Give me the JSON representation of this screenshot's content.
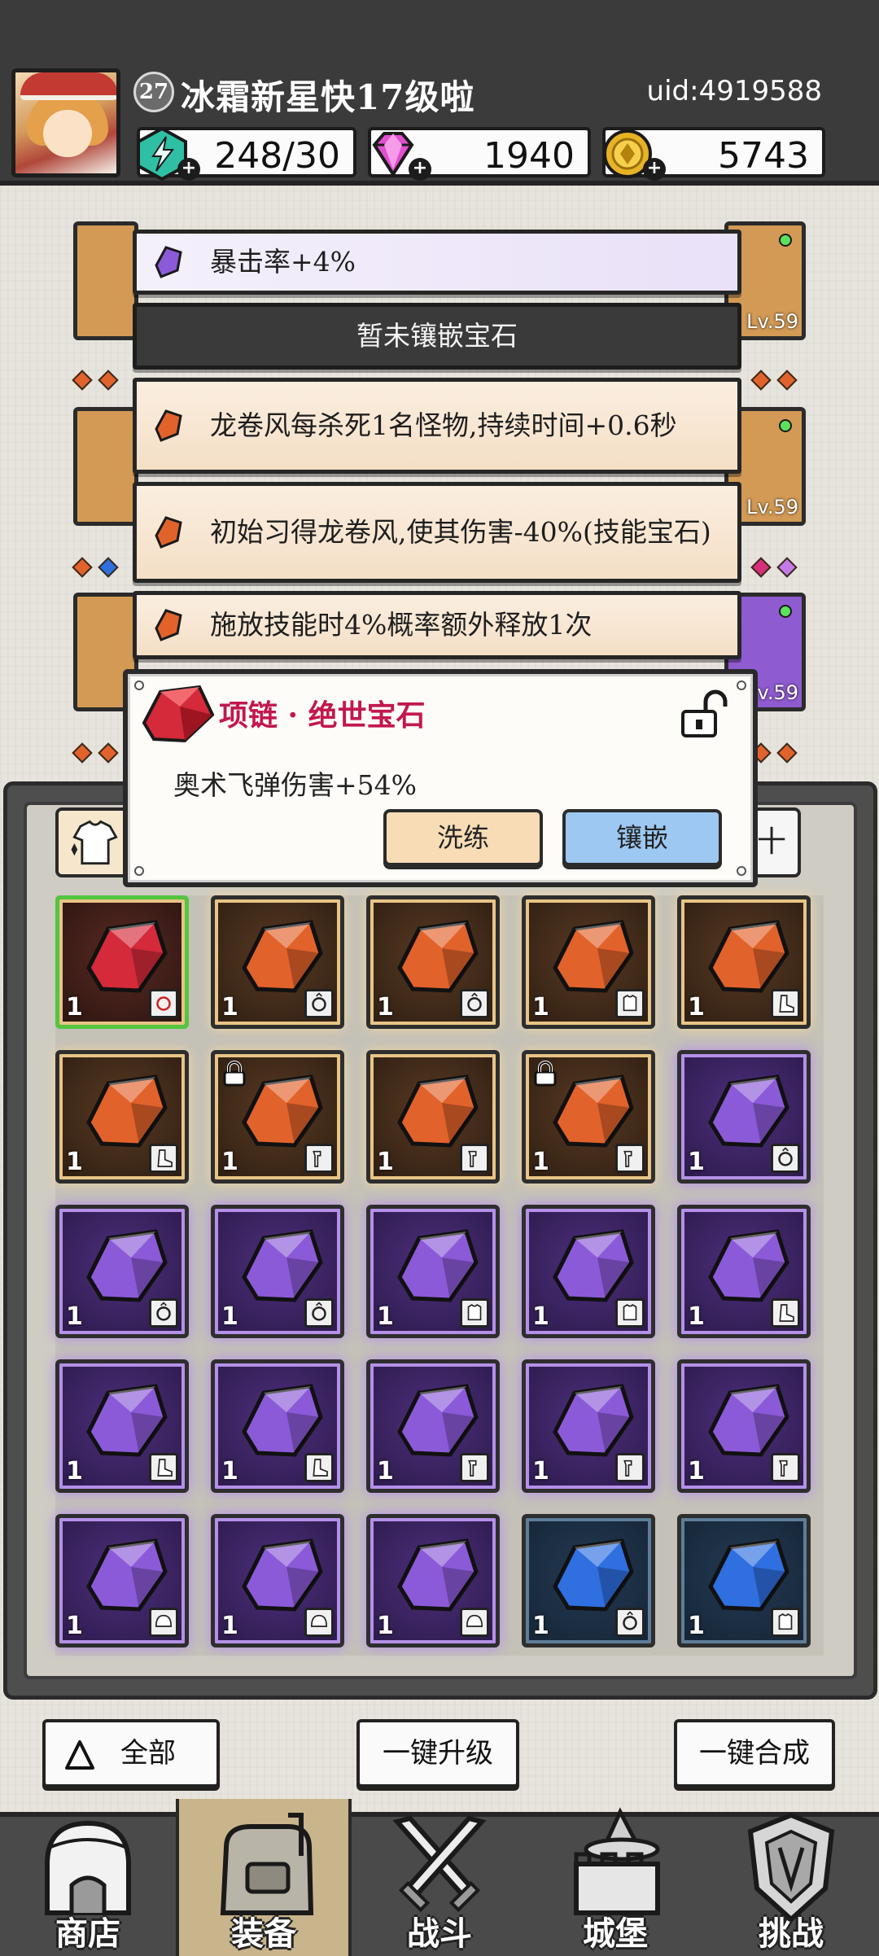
{
  "player": {
    "level": "27",
    "name": "冰霜新星快17级啦",
    "uid": "uid:4919588"
  },
  "resources": {
    "energy": "248/30",
    "gems": "1940",
    "coins": "5743"
  },
  "equipment": {
    "levels": [
      "Lv.59",
      "Lv.59",
      "Lv.59"
    ]
  },
  "affixes": [
    {
      "text": "暴击率+4%",
      "rarity": "purple"
    },
    {
      "text": "暂未镶嵌宝石",
      "rarity": "empty"
    },
    {
      "text": "龙卷风每杀死1名怪物,持续时间+0.6秒",
      "rarity": "orange"
    },
    {
      "text": "初始习得龙卷风,使其伤害-40%(技能宝石)",
      "rarity": "orange"
    },
    {
      "text": "施放技能时4%概率额外释放1次",
      "rarity": "orange"
    }
  ],
  "gem_dialog": {
    "title": "项链 · 绝世宝石",
    "description": "奥术飞弹伤害+54%",
    "wash_label": "洗练",
    "inlay_label": "镶嵌"
  },
  "filter": {
    "right_label": "十"
  },
  "inventory": [
    {
      "rarity": "red",
      "count": "1",
      "type": "necklace",
      "locked": false
    },
    {
      "rarity": "orange",
      "count": "1",
      "type": "ring",
      "locked": false
    },
    {
      "rarity": "orange",
      "count": "1",
      "type": "ring",
      "locked": false
    },
    {
      "rarity": "orange",
      "count": "1",
      "type": "armor",
      "locked": false
    },
    {
      "rarity": "orange",
      "count": "1",
      "type": "boots",
      "locked": false
    },
    {
      "rarity": "orange",
      "count": "1",
      "type": "boots",
      "locked": false
    },
    {
      "rarity": "orange",
      "count": "1",
      "type": "weapon",
      "locked": true
    },
    {
      "rarity": "orange",
      "count": "1",
      "type": "weapon",
      "locked": false
    },
    {
      "rarity": "orange",
      "count": "1",
      "type": "weapon",
      "locked": true
    },
    {
      "rarity": "purple",
      "count": "1",
      "type": "ring",
      "locked": false
    },
    {
      "rarity": "purple",
      "count": "1",
      "type": "ring",
      "locked": false
    },
    {
      "rarity": "purple",
      "count": "1",
      "type": "ring",
      "locked": false
    },
    {
      "rarity": "purple",
      "count": "1",
      "type": "armor",
      "locked": false
    },
    {
      "rarity": "purple",
      "count": "1",
      "type": "armor",
      "locked": false
    },
    {
      "rarity": "purple",
      "count": "1",
      "type": "boots",
      "locked": false
    },
    {
      "rarity": "purple",
      "count": "1",
      "type": "boots",
      "locked": false
    },
    {
      "rarity": "purple",
      "count": "1",
      "type": "boots",
      "locked": false
    },
    {
      "rarity": "purple",
      "count": "1",
      "type": "weapon",
      "locked": false
    },
    {
      "rarity": "purple",
      "count": "1",
      "type": "weapon",
      "locked": false
    },
    {
      "rarity": "purple",
      "count": "1",
      "type": "weapon",
      "locked": false
    },
    {
      "rarity": "purple",
      "count": "1",
      "type": "helmet",
      "locked": false
    },
    {
      "rarity": "purple",
      "count": "1",
      "type": "helmet",
      "locked": false
    },
    {
      "rarity": "purple",
      "count": "1",
      "type": "helmet",
      "locked": false
    },
    {
      "rarity": "blue",
      "count": "1",
      "type": "ring",
      "locked": false
    },
    {
      "rarity": "blue",
      "count": "1",
      "type": "armor",
      "locked": false
    }
  ],
  "actions": {
    "all_label": "全部",
    "upgrade_label": "一键升级",
    "merge_label": "一键合成"
  },
  "nav": [
    {
      "label": "商店",
      "icon": "shop-icon"
    },
    {
      "label": "装备",
      "icon": "equipment-bag-icon",
      "active": true
    },
    {
      "label": "战斗",
      "icon": "crossed-swords-icon"
    },
    {
      "label": "城堡",
      "icon": "castle-icon"
    },
    {
      "label": "挑战",
      "icon": "shield-icon"
    }
  ],
  "colors": {
    "gem_orange": "#e2622b",
    "gem_purple": "#8b5ad8",
    "gem_red": "#d42a3a",
    "gem_blue": "#2f6fe0",
    "dialog_title": "#c2184b"
  }
}
